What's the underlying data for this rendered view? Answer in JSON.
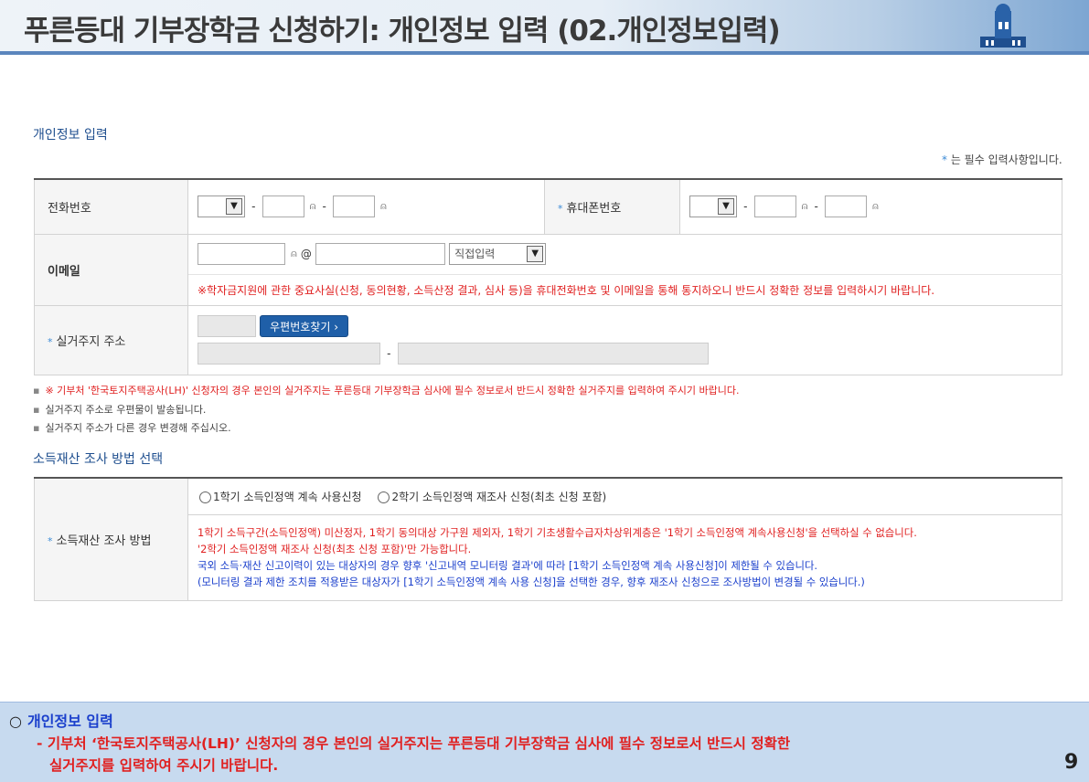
{
  "banner": {
    "title": "푸른등대 기부장학금 신청하기: 개인정보 입력 (02.개인정보입력)"
  },
  "personal": {
    "section_title": "개인정보 입력",
    "required_note_star": "*",
    "required_note": "는 필수 입력사항입니다.",
    "phone_label": "전화번호",
    "mobile_star": "*",
    "mobile_label": "휴대폰번호",
    "email_label": "이메일",
    "email_at": "@",
    "email_domain_select": "직접입력",
    "email_notice": "※학자금지원에 관한 중요사실(신청, 동의현황, 소득산정 결과, 심사 등)을 휴대전화번호 및 이메일을 통해 통지하오니 반드시 정확한 정보를 입력하시기 바랍니다.",
    "address_star": "*",
    "address_label": "실거주지 주소",
    "zip_button": "우편번호찾기 ›",
    "address_dash": "-",
    "dash": "-"
  },
  "notes": [
    "※ 기부처 '한국토지주택공사(LH)' 신청자의 경우 본인의 실거주지는 푸른등대 기부장학금 심사에 필수 정보로서 반드시 정확한 실거주지를 입력하여 주시기 바랍니다.",
    "실거주지 주소로 우편물이 발송됩니다.",
    "실거주지 주소가 다른 경우 변경해 주십시오."
  ],
  "income": {
    "section_title": "소득재산 조사 방법 선택",
    "label_star": "*",
    "label": "소득재산 조사 방법",
    "option1": "1학기 소득인정액 계속 사용신청",
    "option2": "2학기 소득인정액 재조사 신청(최초 신청 포함)",
    "red1": "1학기 소득구간(소득인정액) 미산정자, 1학기 동의대상 가구원 제외자, 1학기 기초생활수급자차상위계층은 '1학기 소득인정액 계속사용신청'을 선택하실 수 없습니다.",
    "red2": "'2학기 소득인정액 재조사 신청(최초 신청 포함)'만 가능합니다.",
    "blue1": "국외 소득·재산 신고이력이 있는 대상자의 경우 향후 '신고내역 모니터링 결과'에 따라 [1학기 소득인정액 계속 사용신청]이 제한될 수 있습니다.",
    "blue2": "(모니터링 결과 제한 조치를 적용받은 대상자가 [1학기 소득인정액 계속 사용 신청]을 선택한 경우, 향후 재조사 신청으로 조사방법이 변경될 수 있습니다.)"
  },
  "info": {
    "heading_mark": "○",
    "heading": "개인정보 입력",
    "line1": "- 기부처 ‘한국토지주택공사(LH)’ 신청자의 경우 본인의 실거주지는 푸른등대 기부장학금 심사에 필수 정보로서 반드시 정확한",
    "line2": "실거주지를 입력하여 주시기 바랍니다.",
    "page": "9"
  },
  "colors": {
    "accent": "#1f5fa8",
    "warning": "#e02020",
    "info_blue": "#1a3fcc",
    "info_bg": "#c7daef"
  },
  "icons": {
    "select_arrow": "chevron-down-icon",
    "input_hint": "mouse-icon",
    "bullet": "square-bullet-icon"
  }
}
